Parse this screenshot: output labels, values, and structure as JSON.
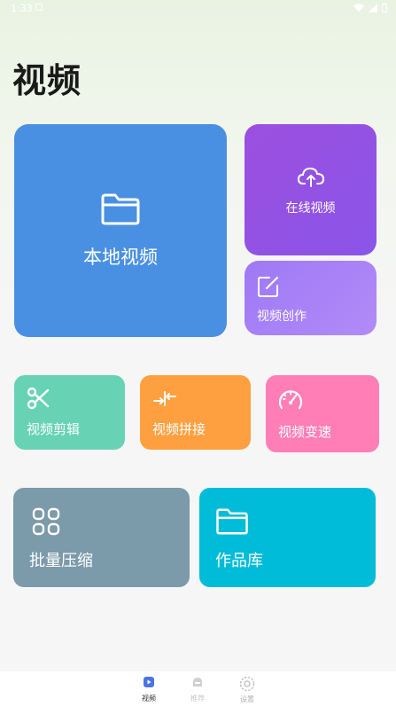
{
  "status_bar": {
    "time": "1:33"
  },
  "page_title": "视频",
  "cards": {
    "local_video": "本地视频",
    "online_video": "在线视频",
    "video_create": "视频创作",
    "video_cut": "视频剪辑",
    "video_join": "视频拼接",
    "video_speed": "视频变速",
    "batch_compress": "批量压缩",
    "works_library": "作品库"
  },
  "bottom_nav": {
    "video": "视频",
    "recommend": "推荐",
    "settings": "设置"
  },
  "colors": {
    "local_video": "#4a90e2",
    "online_video": "#9c4fe0",
    "video_create": "#a57ff6",
    "video_cut": "#67d3b4",
    "video_join": "#ffa040",
    "video_speed": "#ff7eb6",
    "batch_compress": "#7b9aaa",
    "works_library": "#00bcd8"
  },
  "icons": {
    "local_video": "folder-icon",
    "online_video": "cloud-upload-icon",
    "video_create": "edit-icon",
    "video_cut": "scissors-icon",
    "video_join": "merge-arrows-icon",
    "video_speed": "speedometer-icon",
    "batch_compress": "grid-icon",
    "works_library": "folder-icon"
  }
}
